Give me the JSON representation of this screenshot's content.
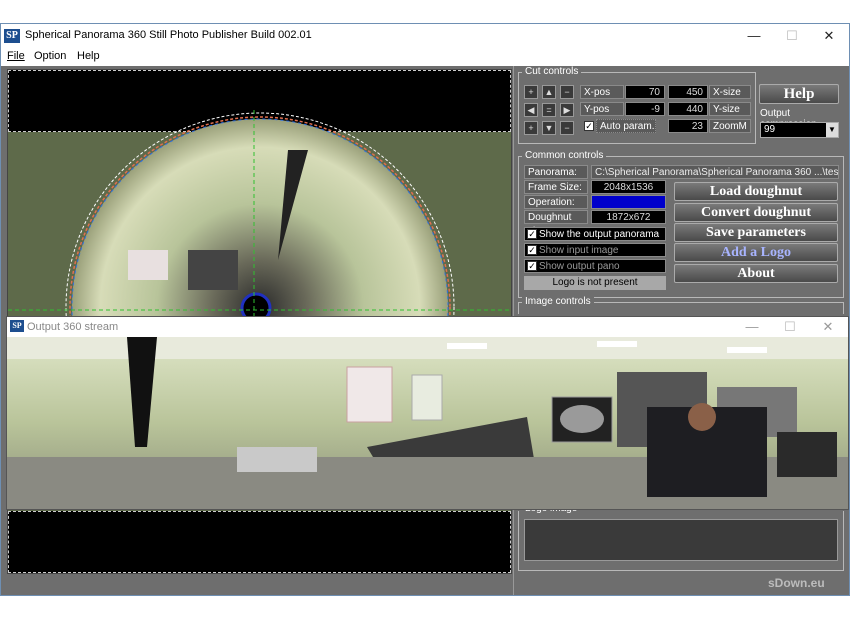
{
  "window": {
    "icon": "SP",
    "title": "Spherical Panorama 360 Still Photo Publisher  Build 002.01",
    "minimize": "—",
    "maximize": "☐",
    "close": "✕"
  },
  "menu": [
    "File",
    "Option",
    "Help"
  ],
  "cut_controls": {
    "title": "Cut controls",
    "xpos_label": "X-pos",
    "xpos_value": "70",
    "xsize_value": "450",
    "xsize_label": "X-size",
    "ypos_label": "Y-pos",
    "ypos_value": "-9",
    "ysize_value": "440",
    "ysize_label": "Y-size",
    "auto_param_label": "Auto param.",
    "zoom_value": "23",
    "zoom_label": "ZoomM"
  },
  "help_button": "Help",
  "output_compression": {
    "label": "Output compression",
    "value": "99"
  },
  "common_controls": {
    "title": "Common controls",
    "panorama_label": "Panorama:",
    "panorama_value": "C:\\Spherical Panorama\\Spherical Panorama 360 ...\\test.jpg",
    "frame_size_label": "Frame Size:",
    "frame_size_value": "2048x1536",
    "operation_label": "Operation:",
    "operation_value": "",
    "doughnut_size_label": "Doughnut size:",
    "doughnut_size_value": "1872x672",
    "show_output_panorama": "Show the output panorama",
    "show_input_image": "Show input image",
    "show_output_pano": "Show output pano",
    "logo_status": "Logo is not present"
  },
  "buttons": {
    "load_doughnut": "Load doughnut",
    "convert_doughnut": "Convert doughnut",
    "save_parameters": "Save parameters",
    "add_logo": "Add a Logo",
    "about": "About"
  },
  "image_controls": {
    "title": "Image controls"
  },
  "logo_image": {
    "title": "Logo image"
  },
  "watermark": "sDown.eu",
  "output_window": {
    "icon": "SP",
    "title": "Output 360 stream",
    "minimize": "—",
    "maximize": "☐",
    "close": "✕"
  },
  "colors": {
    "panel_bg": "#6e6e6e",
    "operation_highlight": "#0000cc",
    "add_logo_text": "#a8b4ff"
  }
}
